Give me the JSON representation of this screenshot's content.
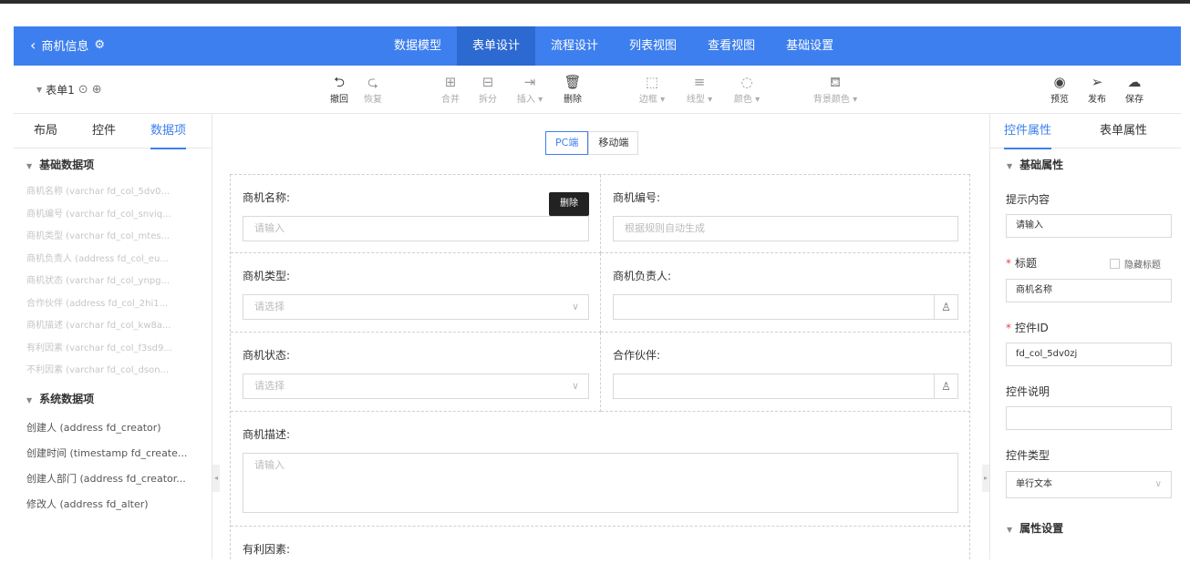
{
  "header": {
    "back_label": "商机信息",
    "nav_tabs": [
      "数据模型",
      "表单设计",
      "流程设计",
      "列表视图",
      "查看视图",
      "基础设置"
    ],
    "active_tab": "表单设计"
  },
  "toolbar": {
    "form_name": "表单1",
    "tools": {
      "undo": "撤回",
      "redo": "恢复",
      "merge": "合并",
      "split": "拆分",
      "insert": "插入 ▾",
      "delete": "删除",
      "border": "边框 ▾",
      "linetype": "线型 ▾",
      "color": "颜色 ▾",
      "bgcolor": "背景颜色 ▾",
      "preview": "预览",
      "publish": "发布",
      "save": "保存"
    }
  },
  "left_panel": {
    "tabs": [
      "布局",
      "控件",
      "数据项"
    ],
    "active_tab": "数据项",
    "basic_section": "基础数据项",
    "basic_items": [
      "商机名称 (varchar fd_col_5dv0...",
      "商机编号 (varchar fd_col_snviq...",
      "商机类型 (varchar fd_col_mtes...",
      "商机负责人 (address fd_col_eu...",
      "商机状态 (varchar fd_col_ynpg...",
      "合作伙伴 (address fd_col_2hi1...",
      "商机描述 (varchar fd_col_kw8a...",
      "有利因素 (varchar fd_col_f3sd9...",
      "不利因素 (varchar fd_col_dson..."
    ],
    "system_section": "系统数据项",
    "system_items": [
      "创建人 (address fd_creator)",
      "创建时间 (timestamp fd_create...",
      "创建人部门 (address fd_creator...",
      "修改人 (address fd_alter)"
    ]
  },
  "canvas": {
    "segments": [
      "PC端",
      "移动端"
    ],
    "active_segment": "PC端",
    "tooltip": "删除",
    "fields": {
      "name_label": "商机名称:",
      "name_placeholder": "请输入",
      "code_label": "商机编号:",
      "code_placeholder": "根据规则自动生成",
      "type_label": "商机类型:",
      "type_placeholder": "请选择",
      "owner_label": "商机负责人:",
      "status_label": "商机状态:",
      "status_placeholder": "请选择",
      "partner_label": "合作伙伴:",
      "desc_label": "商机描述:",
      "desc_placeholder": "请输入",
      "factor_label": "有利因素:"
    }
  },
  "right_panel": {
    "tabs": [
      "控件属性",
      "表单属性"
    ],
    "active_tab": "控件属性",
    "basic_section": "基础属性",
    "hint_label": "提示内容",
    "hint_value": "请输入",
    "title_label": "标题",
    "hide_title_label": "隐藏标题",
    "title_value": "商机名称",
    "id_label": "控件ID",
    "id_value": "fd_col_5dv0zj",
    "desc_label": "控件说明",
    "desc_value": "",
    "type_label": "控件类型",
    "type_value": "单行文本",
    "attr_section": "属性设置"
  },
  "colors": {
    "primary": "#3d7fee",
    "active_nav": "#2c69d1",
    "required": "#e5474b"
  }
}
